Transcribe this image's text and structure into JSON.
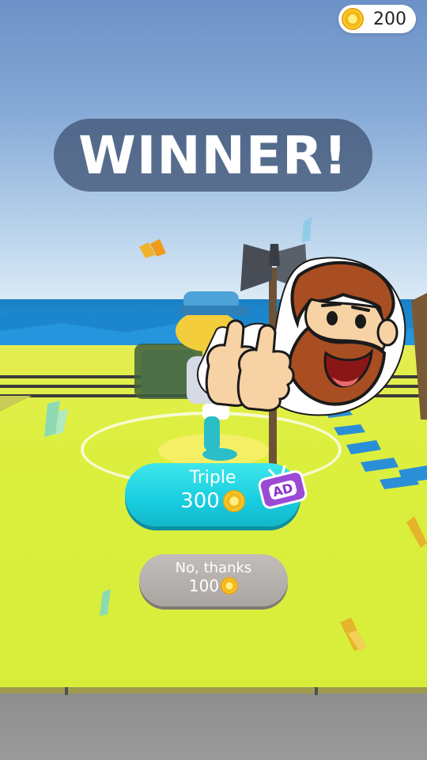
{
  "header": {
    "coins": {
      "icon": "coin-icon",
      "value": "200"
    }
  },
  "banner": {
    "title": "WINNER!"
  },
  "rewards": {
    "triple": {
      "label": "Triple",
      "amount": "300",
      "coin_icon": "coin-icon",
      "ad_badge": {
        "icon": "tv-ad-icon",
        "text": "AD"
      }
    },
    "no_thanks": {
      "label": "No, thanks",
      "amount": "100",
      "coin_icon": "coin-icon"
    }
  },
  "scene": {
    "sticker_icon": "bearded-man-thumbs-up-sticker",
    "character_icon": "player-character",
    "weapon_icon": "battle-axe-icon"
  },
  "colors": {
    "triple_button": "#18cde0",
    "no_thanks_button": "#aaa5a1",
    "banner_bg": "#3c4e6e",
    "ground": "#dcef3e",
    "coin": "#f3b81a",
    "ad_badge": "#9b4ad6"
  }
}
